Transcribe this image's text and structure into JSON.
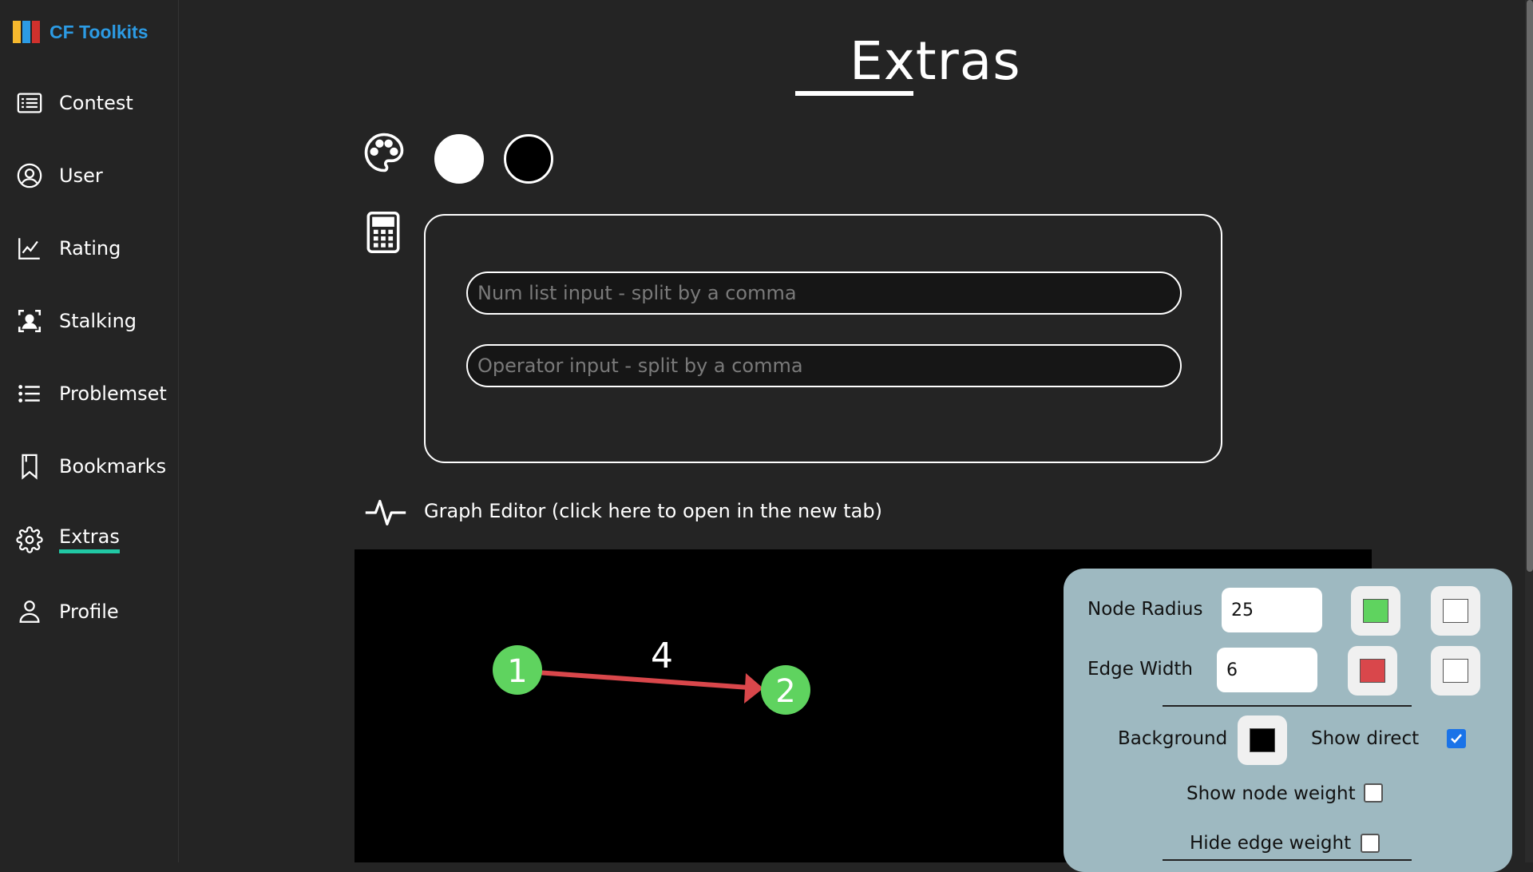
{
  "brand": {
    "name": "CF Toolkits",
    "logo_colors": [
      "#f5b82e",
      "#2c9be4",
      "#d0312d"
    ]
  },
  "sidebar": {
    "items": [
      {
        "label": "Contest",
        "icon": "list-box-icon"
      },
      {
        "label": "User",
        "icon": "user-circle-icon"
      },
      {
        "label": "Rating",
        "icon": "line-chart-icon"
      },
      {
        "label": "Stalking",
        "icon": "user-scan-icon"
      },
      {
        "label": "Problemset",
        "icon": "list-icon"
      },
      {
        "label": "Bookmarks",
        "icon": "bookmark-icon"
      },
      {
        "label": "Extras",
        "icon": "gear-icon",
        "active": true
      },
      {
        "label": "Profile",
        "icon": "person-icon"
      }
    ],
    "accent": "#21c8a4"
  },
  "page": {
    "title": "Extras"
  },
  "theme": {
    "icon": "palette-icon",
    "options": [
      "white",
      "black"
    ]
  },
  "calculator": {
    "icon": "calculator-icon",
    "num_placeholder": "Num list input - split by a comma",
    "op_placeholder": "Operator input - split by a comma"
  },
  "graph_editor": {
    "icon": "pulse-icon",
    "link_text": "Graph Editor (click here to open in the new tab)",
    "graph": {
      "nodes": [
        "1",
        "2"
      ],
      "edge_weight": "4",
      "node_color": "#5fd35f",
      "edge_color": "#d9474b"
    },
    "panel": {
      "node_radius_label": "Node Radius",
      "node_radius_value": "25",
      "node_color": "#5fd35f",
      "node_text_color": "#ffffff",
      "edge_width_label": "Edge Width",
      "edge_width_value": "6",
      "edge_color": "#d9474b",
      "edge_text_color": "#ffffff",
      "background_label": "Background",
      "background_color": "#000000",
      "show_direct_label": "Show direct",
      "show_direct": true,
      "show_node_weight_label": "Show node weight",
      "show_node_weight": false,
      "hide_edge_weight_label": "Hide edge weight",
      "hide_edge_weight": false
    }
  }
}
